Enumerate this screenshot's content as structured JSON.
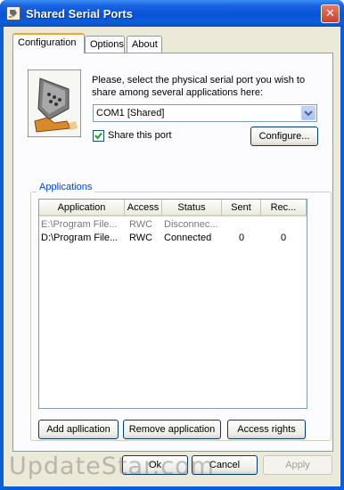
{
  "window": {
    "title": "Shared Serial Ports",
    "close_glyph": "✕"
  },
  "tabs": [
    {
      "label": "Configuration",
      "active": true
    },
    {
      "label": "Options",
      "active": false
    },
    {
      "label": "About",
      "active": false
    }
  ],
  "config": {
    "prompt": "Please, select the physical serial port you wish to share among several applications here:",
    "port_value": "COM1 [Shared]",
    "share_label": "Share this port",
    "share_checked": true,
    "configure_label": "Configure..."
  },
  "applications": {
    "group_label": "Applications",
    "columns": [
      "Application",
      "Access",
      "Status",
      "Sent",
      "Rec..."
    ],
    "rows": [
      {
        "application": "E:\\Program File...",
        "access": "RWC",
        "status": "Disconnec...",
        "sent": "",
        "received": "",
        "dim": true
      },
      {
        "application": "D:\\Program File...",
        "access": "RWC",
        "status": "Connected",
        "sent": "0",
        "received": "0",
        "dim": false
      }
    ],
    "add_label": "Add apllication",
    "remove_label": "Remove application",
    "rights_label": "Access rights"
  },
  "footer": {
    "ok_label": "Ok",
    "cancel_label": "Cancel",
    "apply_label": "Apply"
  },
  "watermark": "UpdateStar.com",
  "colors": {
    "titlebar": "#0a5fd8",
    "dialog": "#ece9d8",
    "group_label": "#0046d5",
    "active_tab_accent": "#f6a421"
  }
}
